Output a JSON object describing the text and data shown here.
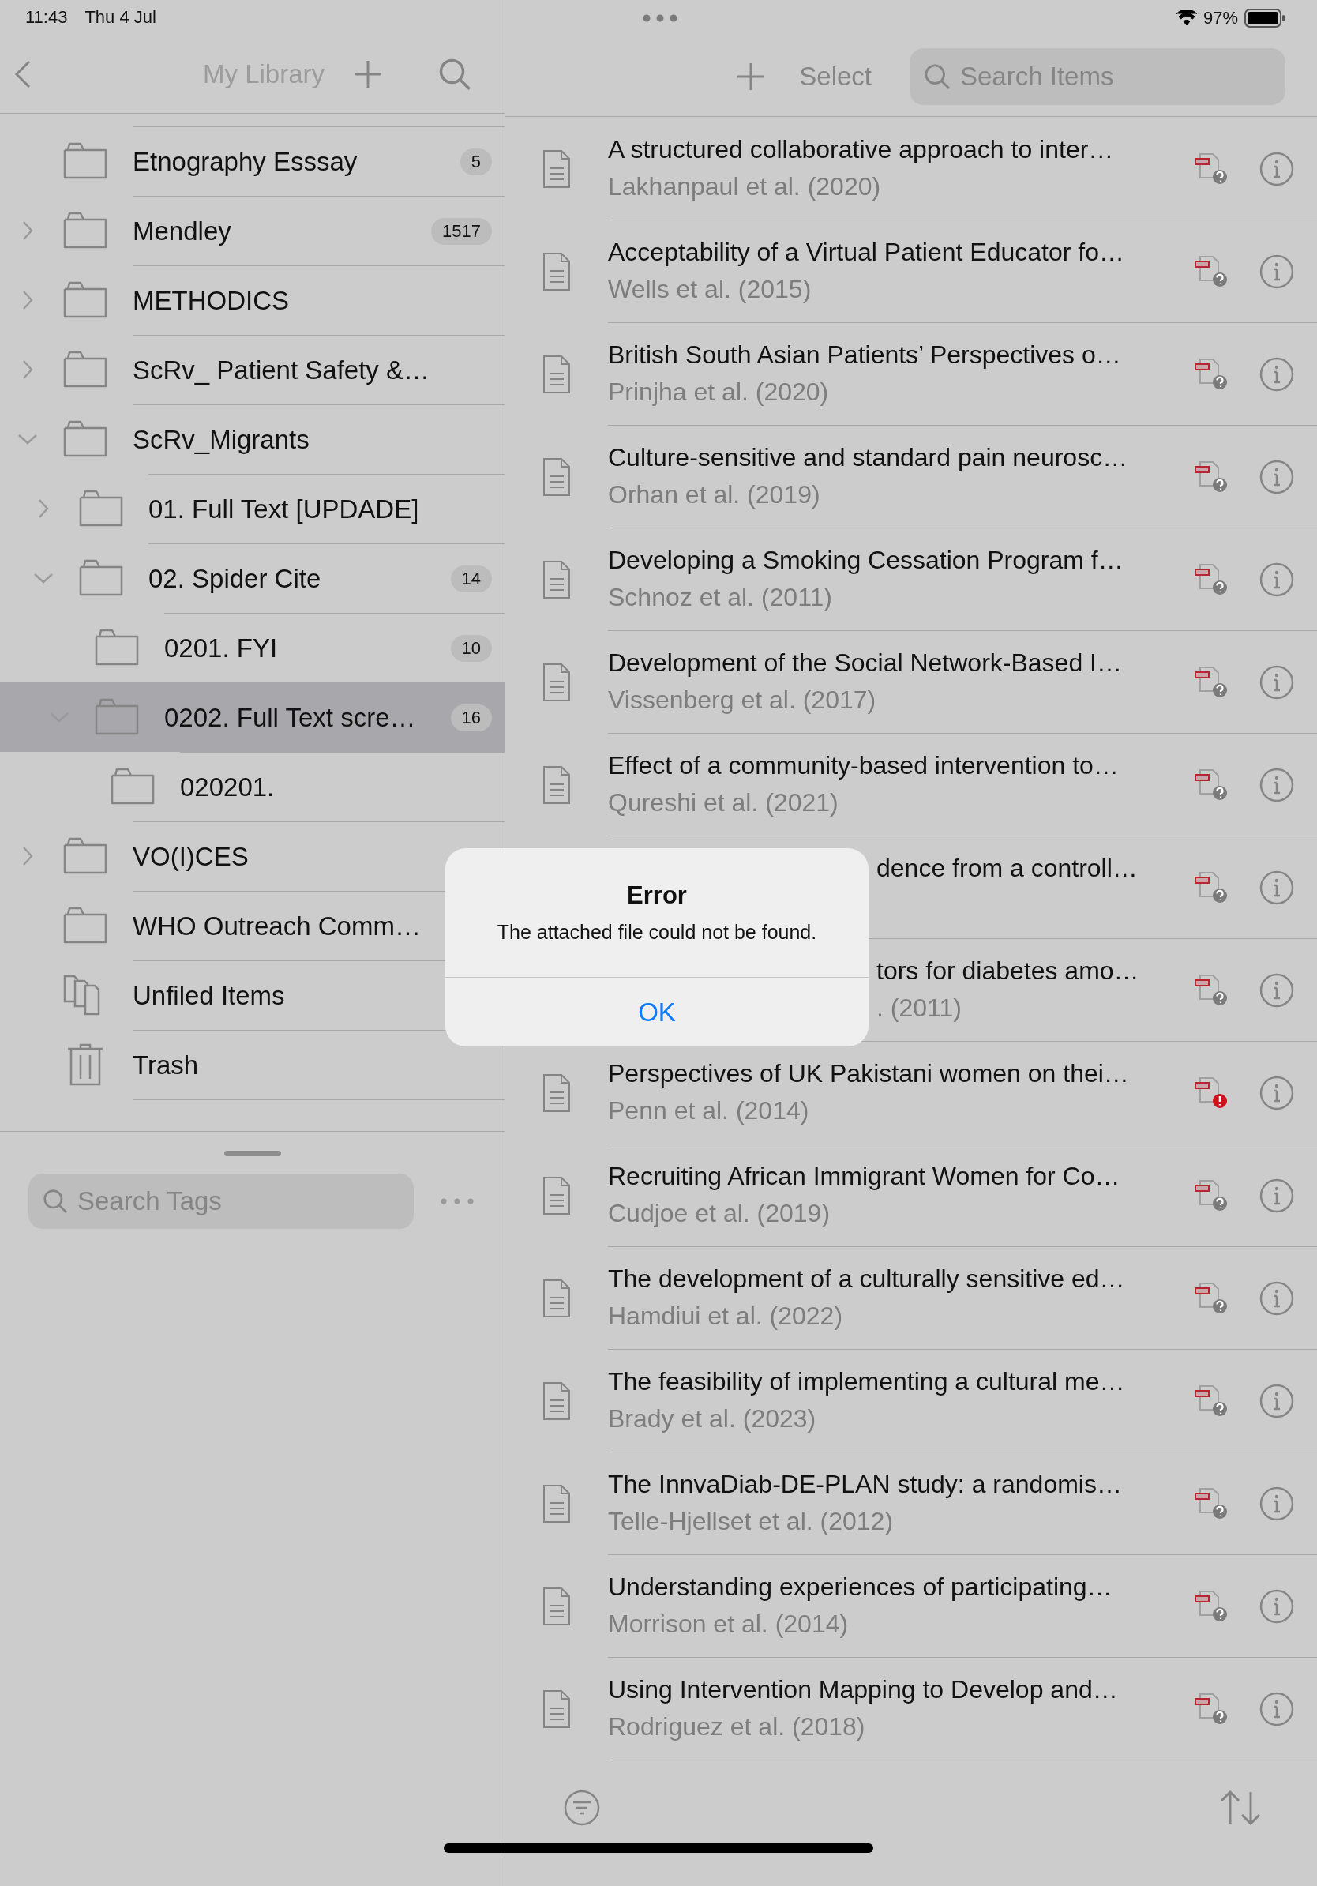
{
  "status_bar": {
    "time": "11:43",
    "date": "Thu 4 Jul",
    "battery": "97%"
  },
  "sidebar": {
    "title": "My Library",
    "tag_search": {
      "placeholder": "Search Tags"
    },
    "collections": [
      {
        "name": "Etnography Esssay",
        "count": "5",
        "kind": "folder",
        "selected": false
      },
      {
        "name": "Mendley",
        "count": "1517",
        "kind": "folder",
        "expanded": false,
        "selected": false
      },
      {
        "name": "METHODICS",
        "kind": "folder",
        "expanded": false,
        "selected": false
      },
      {
        "name": "ScRv_ Patient Safety &…",
        "kind": "folder",
        "expanded": false,
        "selected": false
      },
      {
        "name": "ScRv_Migrants",
        "kind": "folder",
        "expanded": true,
        "selected": false,
        "children": [
          {
            "name": "01. Full Text [UPDADE]",
            "kind": "folder",
            "expanded": false,
            "selected": false
          },
          {
            "name": "02. Spider Cite",
            "count": "14",
            "kind": "folder",
            "expanded": true,
            "selected": false,
            "children": [
              {
                "name": "0201. FYI",
                "count": "10",
                "kind": "folder",
                "selected": false
              },
              {
                "name": "0202. Full Text scre…",
                "count": "16",
                "kind": "folder",
                "expanded": true,
                "selected": true,
                "children": [
                  {
                    "name": "020201.",
                    "kind": "folder",
                    "selected": false
                  }
                ]
              }
            ]
          }
        ]
      },
      {
        "name": "VO(I)CES",
        "kind": "folder",
        "expanded": false,
        "selected": false
      },
      {
        "name": "WHO Outreach Comm…",
        "kind": "folder",
        "selected": false
      },
      {
        "name": "Unfiled Items",
        "kind": "unfiled",
        "selected": false
      },
      {
        "name": "Trash",
        "kind": "trash",
        "selected": false
      }
    ]
  },
  "items_toolbar": {
    "select": "Select",
    "search": {
      "placeholder": "Search Items"
    }
  },
  "items": [
    {
      "title": "A structured collaborative approach to inter…",
      "authors": "Lakhanpaul et al. (2020)",
      "attachment_error": false,
      "partly_hidden": false
    },
    {
      "title": "Acceptability of a Virtual Patient Educator fo…",
      "authors": "Wells et al. (2015)",
      "attachment_error": false,
      "partly_hidden": false
    },
    {
      "title": "British South Asian Patients’ Perspectives o…",
      "authors": "Prinjha et al. (2020)",
      "attachment_error": false,
      "partly_hidden": false
    },
    {
      "title": "Culture-sensitive and standard pain neurosc…",
      "authors": "Orhan et al. (2019)",
      "attachment_error": false,
      "partly_hidden": false
    },
    {
      "title": "Developing a Smoking Cessation Program f…",
      "authors": "Schnoz et al. (2011)",
      "attachment_error": false,
      "partly_hidden": false
    },
    {
      "title": "Development of the Social Network-Based I…",
      "authors": "Vissenberg et al. (2017)",
      "attachment_error": false,
      "partly_hidden": false
    },
    {
      "title": "Effect of a community-based intervention to…",
      "authors": "Qureshi et al. (2021)",
      "attachment_error": false,
      "partly_hidden": false
    },
    {
      "title": "dence from a controll…",
      "attachment_error": false,
      "partly_hidden": true
    },
    {
      "title": "tors for diabetes amo…",
      "authors": ". (2011)",
      "attachment_error": false,
      "partly_hidden": true
    },
    {
      "title": "Perspectives of UK Pakistani women on thei…",
      "authors": "Penn et al. (2014)",
      "attachment_error": true,
      "partly_hidden": false
    },
    {
      "title": "Recruiting African Immigrant Women for Co…",
      "authors": "Cudjoe et al. (2019)",
      "attachment_error": false,
      "partly_hidden": false
    },
    {
      "title": "The development of a culturally sensitive ed…",
      "authors": "Hamdiui et al. (2022)",
      "attachment_error": false,
      "partly_hidden": false
    },
    {
      "title": "The feasibility of implementing a cultural me…",
      "authors": "Brady et al. (2023)",
      "attachment_error": false,
      "partly_hidden": false
    },
    {
      "title": "The InnvaDiab-DE-PLAN study: a randomis…",
      "authors": "Telle-Hjellset et al. (2012)",
      "attachment_error": false,
      "partly_hidden": false
    },
    {
      "title": "Understanding experiences of participating…",
      "authors": "Morrison et al. (2014)",
      "attachment_error": false,
      "partly_hidden": false
    },
    {
      "title": "Using Intervention Mapping to Develop and…",
      "authors": "Rodriguez et al. (2018)",
      "attachment_error": false,
      "partly_hidden": false
    }
  ],
  "dialog": {
    "title": "Error",
    "message": "The attached file could not be found.",
    "button": "OK"
  }
}
